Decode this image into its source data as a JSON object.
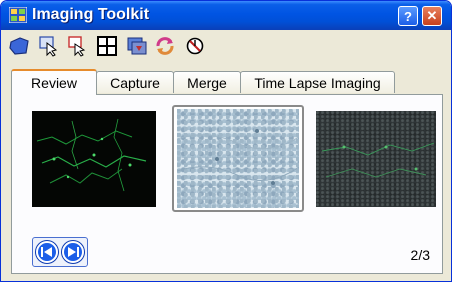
{
  "window": {
    "title": "Imaging Toolkit",
    "help_glyph": "?",
    "close_glyph": "✕"
  },
  "toolbar": {
    "tools": [
      {
        "icon": "shape-select-icon"
      },
      {
        "icon": "capture-cursor-icon"
      },
      {
        "icon": "cursor-pointer-icon"
      },
      {
        "icon": "grid-layout-icon"
      },
      {
        "icon": "import-image-icon"
      },
      {
        "icon": "refresh-icon"
      },
      {
        "icon": "stop-icon"
      }
    ]
  },
  "tabs": [
    {
      "label": "Review",
      "active": true
    },
    {
      "label": "Capture",
      "active": false
    },
    {
      "label": "Merge",
      "active": false
    },
    {
      "label": "Time Lapse Imaging",
      "active": false
    }
  ],
  "review": {
    "page_counter": "2/3",
    "selected_index": 2,
    "thumbnails": [
      {
        "name": "thumbnail-1"
      },
      {
        "name": "thumbnail-2"
      },
      {
        "name": "thumbnail-3"
      }
    ]
  },
  "colors": {
    "title_bar": "#0054e3",
    "active_tab_accent": "#e68b2c",
    "nav_button": "#1c5ee8"
  }
}
